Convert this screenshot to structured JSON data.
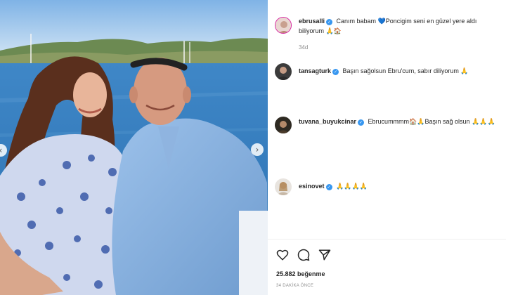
{
  "post": {
    "caption": {
      "username": "ebrusalli",
      "text_part1": "Canım babam ",
      "heart_emoji": "💙",
      "text_part2": "Poncigim seni en güzel yere aldı biliyorum ",
      "emojis": "🙏🏠",
      "time": "34d"
    },
    "comments": [
      {
        "username": "tansagturk",
        "text": "Başın sağolsun Ebru'cum, sabır diliyorum ",
        "emojis": "🙏"
      },
      {
        "username": "tuvana_buyukcinar",
        "text": "Ebrucummmm",
        "emojis_mid": "🏠🙏",
        "text2": "Başın sağ olsun ",
        "emojis": "🙏🙏🙏"
      },
      {
        "username": "esinovet",
        "text": "",
        "emojis": "🙏🙏🙏🙏"
      }
    ],
    "likes_count": "25.882",
    "likes_label": "beğenme",
    "time_ago": "34 DAKİKA ÖNCE"
  },
  "icons": {
    "like": "heart-icon",
    "comment": "comment-icon",
    "share": "share-icon",
    "verified": "verified-badge-icon"
  },
  "colors": {
    "verified": "#3897f0",
    "text": "#262626",
    "muted": "#8e8e8e"
  }
}
